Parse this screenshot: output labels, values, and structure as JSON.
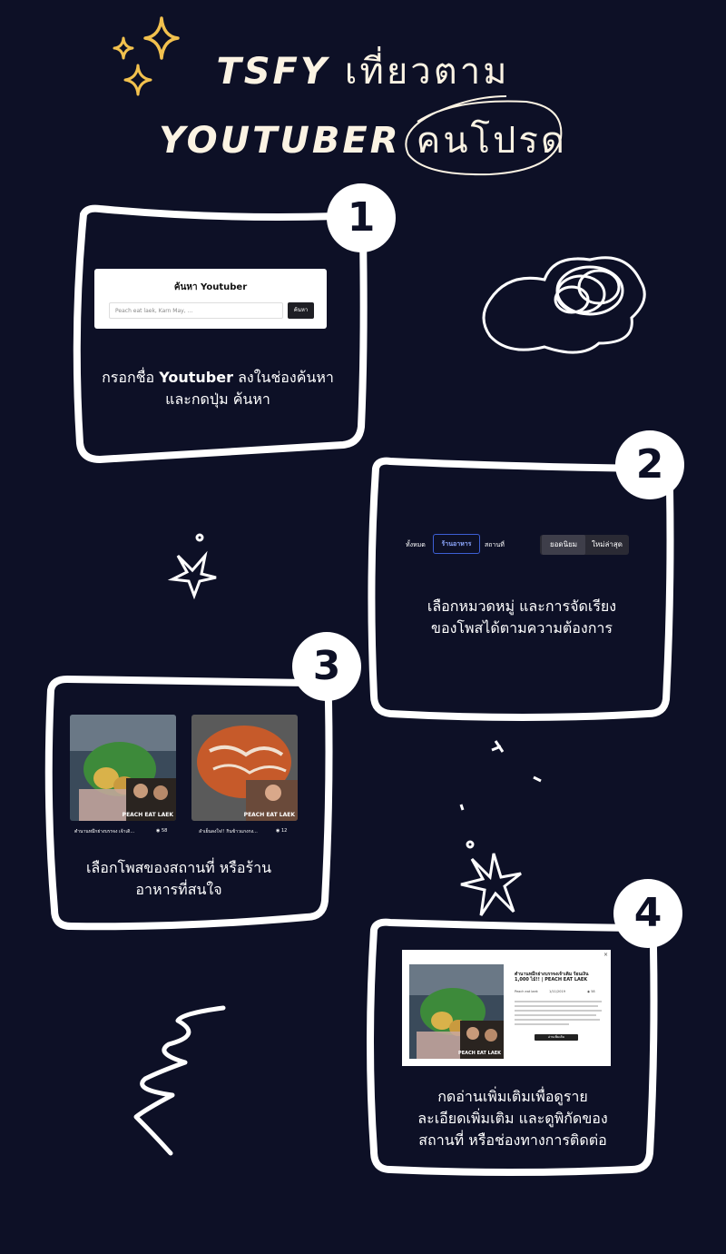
{
  "header": {
    "line1_latin": "TSFY",
    "line1_thai": "เที่ยวตาม",
    "line2_latin": "YOUTUBER",
    "line2_thai": "คนโปรด"
  },
  "steps": [
    {
      "number": "1",
      "desc_pre": "กรอกชื่อ ",
      "desc_bold": "Youtuber",
      "desc_post": " ลงในช่องค้นหา",
      "desc_line2": "และกดปุ่ม ค้นหา"
    },
    {
      "number": "2",
      "desc_line1": "เลือกหมวดหมู่ และการจัดเรียง",
      "desc_line2": "ของโพสได้ตามความต้องการ"
    },
    {
      "number": "3",
      "desc_line1": "เลือกโพสของสถานที่ หรือร้าน",
      "desc_line2": "อาหารที่สนใจ"
    },
    {
      "number": "4",
      "desc_line1": "กดอ่านเพิ่มเติมเพื่อดูราย",
      "desc_line2": "ละเอียดเพิ่มเติม และดูพิกัดของ",
      "desc_line3": "สถานที่ หรือช่องทางการติดต่อ"
    }
  ],
  "search": {
    "title": "ค้นหา Youtuber",
    "placeholder": "Peach eat laek, Karn May, ...",
    "button": "ค้นหา"
  },
  "filters": {
    "tabs": [
      "ทั้งหมด",
      "ร้านอาหาร",
      "สถานที่"
    ],
    "active_tab": "ร้านอาหาร",
    "sort": [
      "ยอดนิยม",
      "ใหม่ล่าสุด"
    ],
    "active_sort": "ยอดนิยม"
  },
  "posts": [
    {
      "caption": "ตำนานหมึกย่างบรรจง เจ้าเดิ...",
      "views": "58",
      "watermark": "PEACH EAT LAEK"
    },
    {
      "caption": "ลำเย็นลงใจ!! กินข้าวแกงกง...",
      "views": "12",
      "watermark": "PEACH EAT LAEK"
    }
  ],
  "modal": {
    "title": "ตำนานหมึกย่างบรรจงเจ้าเดิม ร้อนเงิน 1,000 ไม้!! | PEACH EAT LAEK",
    "author": "Peach eat laek",
    "date": "1/11/2019",
    "views": "58",
    "button": "อ่านเพิ่มเติม",
    "close": "×",
    "watermark": "PEACH EAT LAEK"
  },
  "colors": {
    "background": "#0d1026",
    "title_text": "#fbf3e3",
    "sparkle": "#f2c14e",
    "active_tab": "#3d5fd4"
  }
}
